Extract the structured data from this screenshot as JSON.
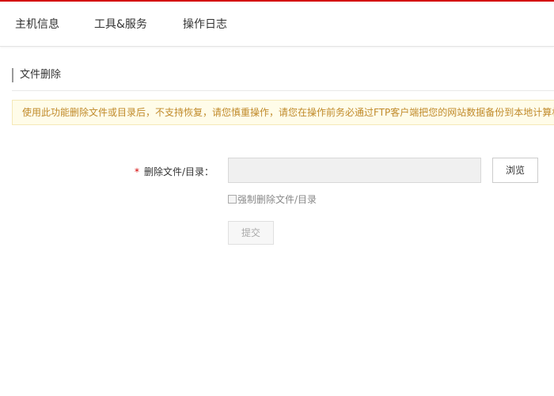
{
  "theme": {
    "accent_color": "#d40000",
    "notice_text_color": "#c08a2a",
    "notice_bg_color": "#fffce9"
  },
  "nav": {
    "items": [
      {
        "label": "主机信息"
      },
      {
        "label": "工具&服务"
      },
      {
        "label": "操作日志"
      }
    ]
  },
  "section": {
    "title": "文件删除"
  },
  "notice": {
    "text": "使用此功能删除文件或目录后，不支持恢复，请您慎重操作，请您在操作前务必通过FTP客户端把您的网站数据备份到本地计算机"
  },
  "form": {
    "required_mark": "*",
    "path_label": "删除文件/目录：",
    "path_value": "",
    "browse_label": "浏览",
    "force_label": "强制删除文件/目录",
    "force_checked": false,
    "submit_label": "提交",
    "submit_disabled": true
  }
}
